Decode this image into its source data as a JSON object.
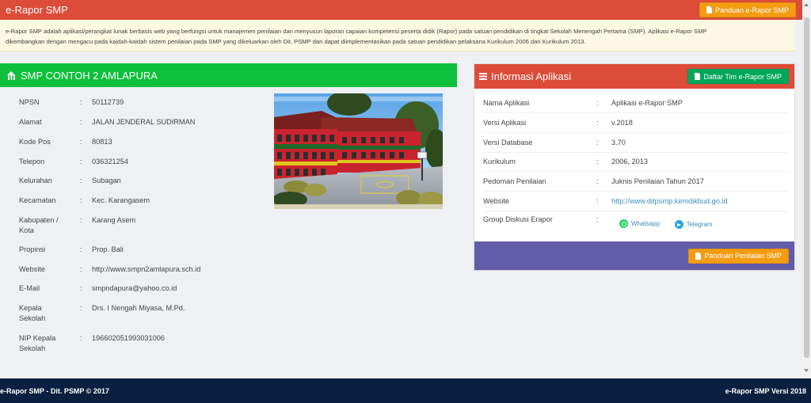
{
  "header": {
    "title": "e-Rapor SMP",
    "guide_button": "Panduan e-Rapor SMP"
  },
  "intro": {
    "line1": "e-Rapor SMP adalah aplikasi/perangkat lunak berbasis web yang berfungsi untuk manajemen penilaian dan menyusun laporan capaian kompetensi peserta didik (Rapor) pada satuan pendidikan di tingkat Sekolah Menengah Pertama (SMP). Aplikasi e-Rapor SMP",
    "line2": "dikembangkan dengan mengacu pada kaidah-kaidah sistem penilaian pada SMP yang dikeluarkan oleh Dit. PSMP dan dapat diimplementasikan pada satuan pendidikan pelaksana Kurikulum 2006 dan Kurikulum 2013."
  },
  "school": {
    "title": "SMP CONTOH 2 AMLAPURA",
    "rows": [
      {
        "label": "NPSN",
        "value": "50112739"
      },
      {
        "label": "Alamat",
        "value": "JALAN JENDERAL SUDIRMAN"
      },
      {
        "label": "Kode Pos",
        "value": "80813"
      },
      {
        "label": "Telepon",
        "value": "036321254"
      },
      {
        "label": "Kelurahan",
        "value": "Subagan"
      },
      {
        "label": "Kecamatan",
        "value": "Kec. Karangasem"
      },
      {
        "label": "Kabupaten / Kota",
        "value": "Karang Asem"
      },
      {
        "label": "Propinsi",
        "value": "Prop. Bali"
      },
      {
        "label": "Website",
        "value": "http://www.smpn2amlapura.sch.id"
      },
      {
        "label": "E-Mail",
        "value": "smpndapura@yahoo.co.id"
      },
      {
        "label": "Kepala Sekolah",
        "value": "Drs. I Nengah Miyasa, M.Pd."
      },
      {
        "label": "NIP Kepala Sekolah",
        "value": "196602051993031006"
      }
    ]
  },
  "app_info": {
    "title": "Informasi Aplikasi",
    "team_button": "Daftar Tim e-Rapor SMP",
    "rows": [
      {
        "label": "Nama Aplikasi",
        "value": "Aplikasi e-Rapor SMP"
      },
      {
        "label": "Versi Aplikasi",
        "value": "v.2018"
      },
      {
        "label": "Versi Database",
        "value": "3.70"
      },
      {
        "label": "Kurikulum",
        "value": "2006, 2013"
      },
      {
        "label": "Pedoman Penilaian",
        "value": "Juknis Penilaian Tahun 2017"
      },
      {
        "label": "Website",
        "value": "http://www.ditpsmp.kemdikbud.go.id"
      },
      {
        "label": "Group Diskusi Erapor",
        "value": ""
      }
    ],
    "whatsapp": "Whatsapp",
    "telegram": "Telegram",
    "assessment_button": "Panduan Penilaian SMP"
  },
  "footer": {
    "left": "e-Rapor SMP - Dit. PSMP © 2017",
    "right": "e-Rapor SMP Versi 2018"
  },
  "colors": {
    "header_red": "#dd4b39",
    "green": "#0ec03b",
    "orange": "#f39c12",
    "purple": "#605ca8",
    "footer_navy": "#0b2040"
  }
}
